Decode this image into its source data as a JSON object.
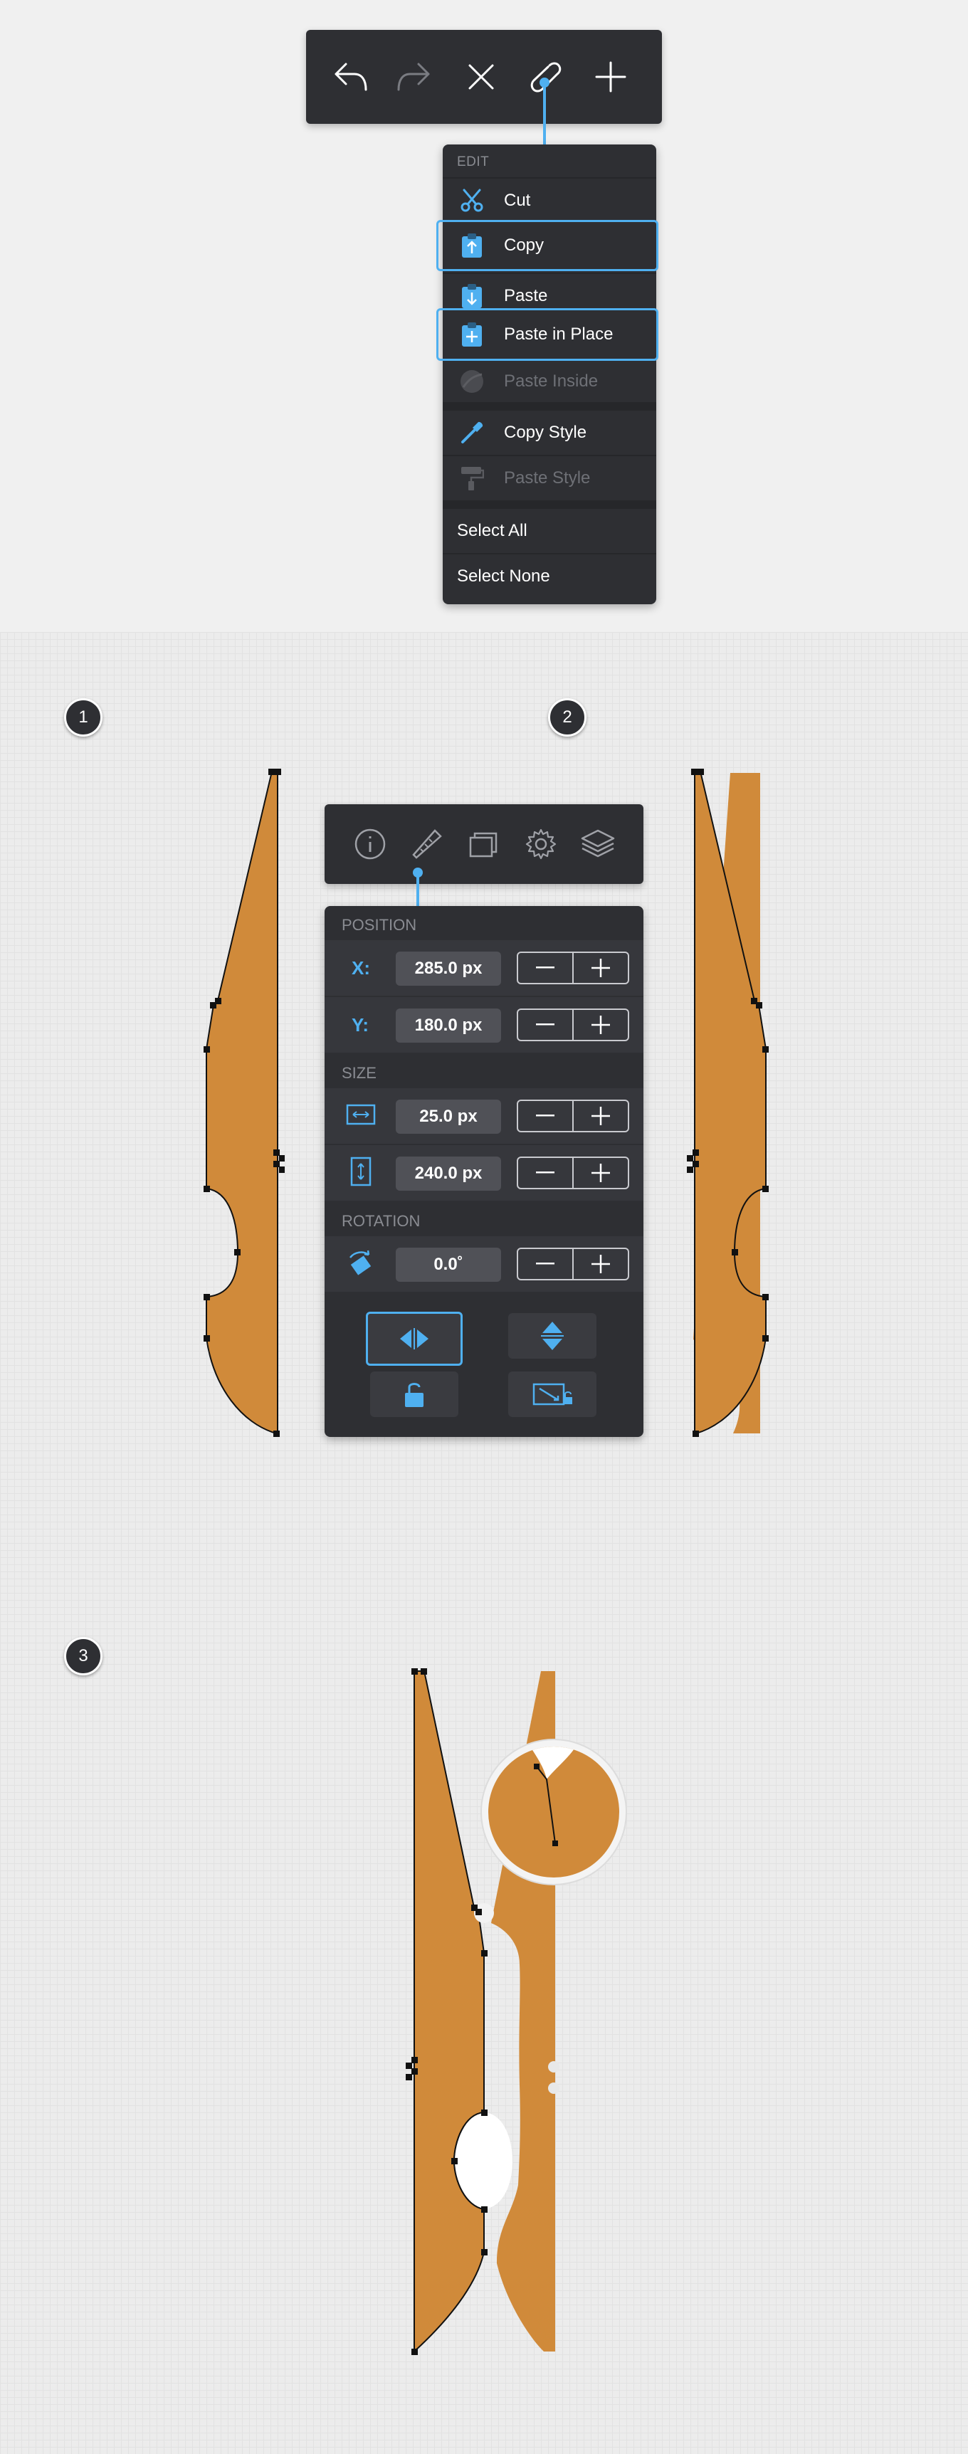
{
  "toolbar": {
    "buttons": [
      "undo-icon",
      "redo-icon",
      "close-icon",
      "paperclip-icon",
      "plus-icon"
    ]
  },
  "edit_menu": {
    "header": "EDIT",
    "items": [
      {
        "label": "Cut",
        "icon": "scissors-icon",
        "enabled": true,
        "selected": false
      },
      {
        "label": "Copy",
        "icon": "clipboard-copy-icon",
        "enabled": true,
        "selected": true
      },
      {
        "label": "Paste",
        "icon": "clipboard-paste-icon",
        "enabled": true,
        "selected": false
      },
      {
        "label": "Paste in Place",
        "icon": "clipboard-paste-in-place-icon",
        "enabled": true,
        "selected": true
      },
      {
        "label": "Paste Inside",
        "icon": "paste-inside-icon",
        "enabled": false,
        "selected": false
      },
      {
        "label": "Copy Style",
        "icon": "eyedropper-icon",
        "enabled": true,
        "selected": false
      },
      {
        "label": "Paste Style",
        "icon": "paint-roller-icon",
        "enabled": false,
        "selected": false
      },
      {
        "label": "Select All",
        "enabled": true,
        "selected": false
      },
      {
        "label": "Select None",
        "enabled": true,
        "selected": false
      }
    ]
  },
  "steps": [
    "1",
    "2",
    "3"
  ],
  "inspector": {
    "tabs": [
      "info-icon",
      "ruler-icon",
      "duplicate-icon",
      "settings-gear-icon",
      "layers-icon"
    ],
    "active_tab": "ruler-icon",
    "position_label": "POSITION",
    "x_label": "X:",
    "x_value": "285.0 px",
    "y_label": "Y:",
    "y_value": "180.0 px",
    "size_label": "SIZE",
    "width_value": "25.0 px",
    "height_value": "240.0 px",
    "rotation_label": "ROTATION",
    "rotation_value": "0.0˚",
    "flip_horizontal_active": true
  },
  "colors": {
    "panel": "#2e2f33",
    "accent": "#4fb0f0",
    "shape_fill": "#d08a3a"
  }
}
